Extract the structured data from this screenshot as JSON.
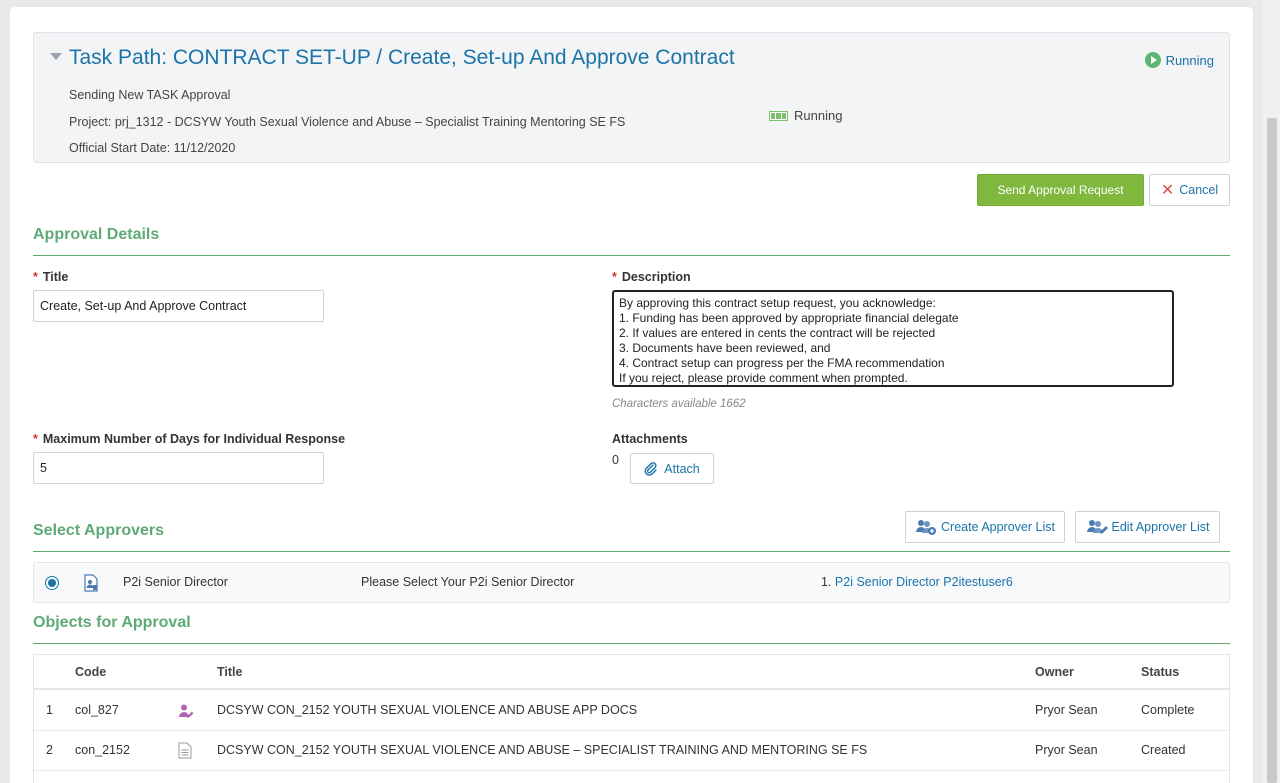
{
  "header": {
    "task_title": "Task Path: CONTRACT SET-UP / Create, Set-up And Approve Contract",
    "status": "Running",
    "subtitle": "Sending New TASK Approval",
    "project": "Project: prj_1312 - DCSYW Youth Sexual Violence and Abuse – Specialist Training Mentoring SE FS",
    "project_status": "Running",
    "start_date": "Official Start Date: 11/12/2020"
  },
  "actions": {
    "send_label": "Send Approval Request",
    "cancel_label": "Cancel"
  },
  "approval_details": {
    "heading": "Approval Details",
    "title_label": "Title",
    "title_value": "Create, Set-up And Approve Contract",
    "description_label": "Description",
    "description_value": "By approving this contract setup request, you acknowledge:\n1. Funding has been approved by appropriate financial delegate\n2. If values are entered in cents the contract will be rejected\n3. Documents have been reviewed, and\n4. Contract setup can progress per the FMA recommendation\nIf you reject, please provide comment when prompted.",
    "chars_available": "Characters available 1662",
    "max_days_label": "Maximum Number of Days for Individual Response",
    "max_days_value": "5",
    "attachments_label": "Attachments",
    "attachments_count": "0",
    "attach_label": "Attach"
  },
  "approvers": {
    "heading": "Select Approvers",
    "create_list_label": "Create Approver List",
    "edit_list_label": "Edit Approver List",
    "row": {
      "role": "P2i Senior Director",
      "instruction": "Please Select Your P2i Senior Director",
      "assigned_prefix": "1.",
      "assigned": "P2i Senior Director P2itestuser6"
    }
  },
  "objects": {
    "heading": "Objects for Approval",
    "columns": {
      "code": "Code",
      "title": "Title",
      "owner": "Owner",
      "status": "Status"
    },
    "rows": [
      {
        "num": "1",
        "code": "col_827",
        "icon": "user-edit-icon",
        "title": "DCSYW CON_2152 YOUTH SEXUAL VIOLENCE AND ABUSE APP DOCS",
        "owner": "Pryor Sean",
        "status": "Complete"
      },
      {
        "num": "2",
        "code": "con_2152",
        "icon": "document-icon",
        "title": "DCSYW CON_2152 YOUTH SEXUAL VIOLENCE AND ABUSE – SPECIALIST TRAINING AND MENTORING SE FS",
        "owner": "Pryor Sean",
        "status": "Created"
      }
    ]
  },
  "colors": {
    "accent": "#1b73a8",
    "section": "#5eaa77",
    "primary_button": "#80b73d",
    "required": "#d9342b"
  }
}
